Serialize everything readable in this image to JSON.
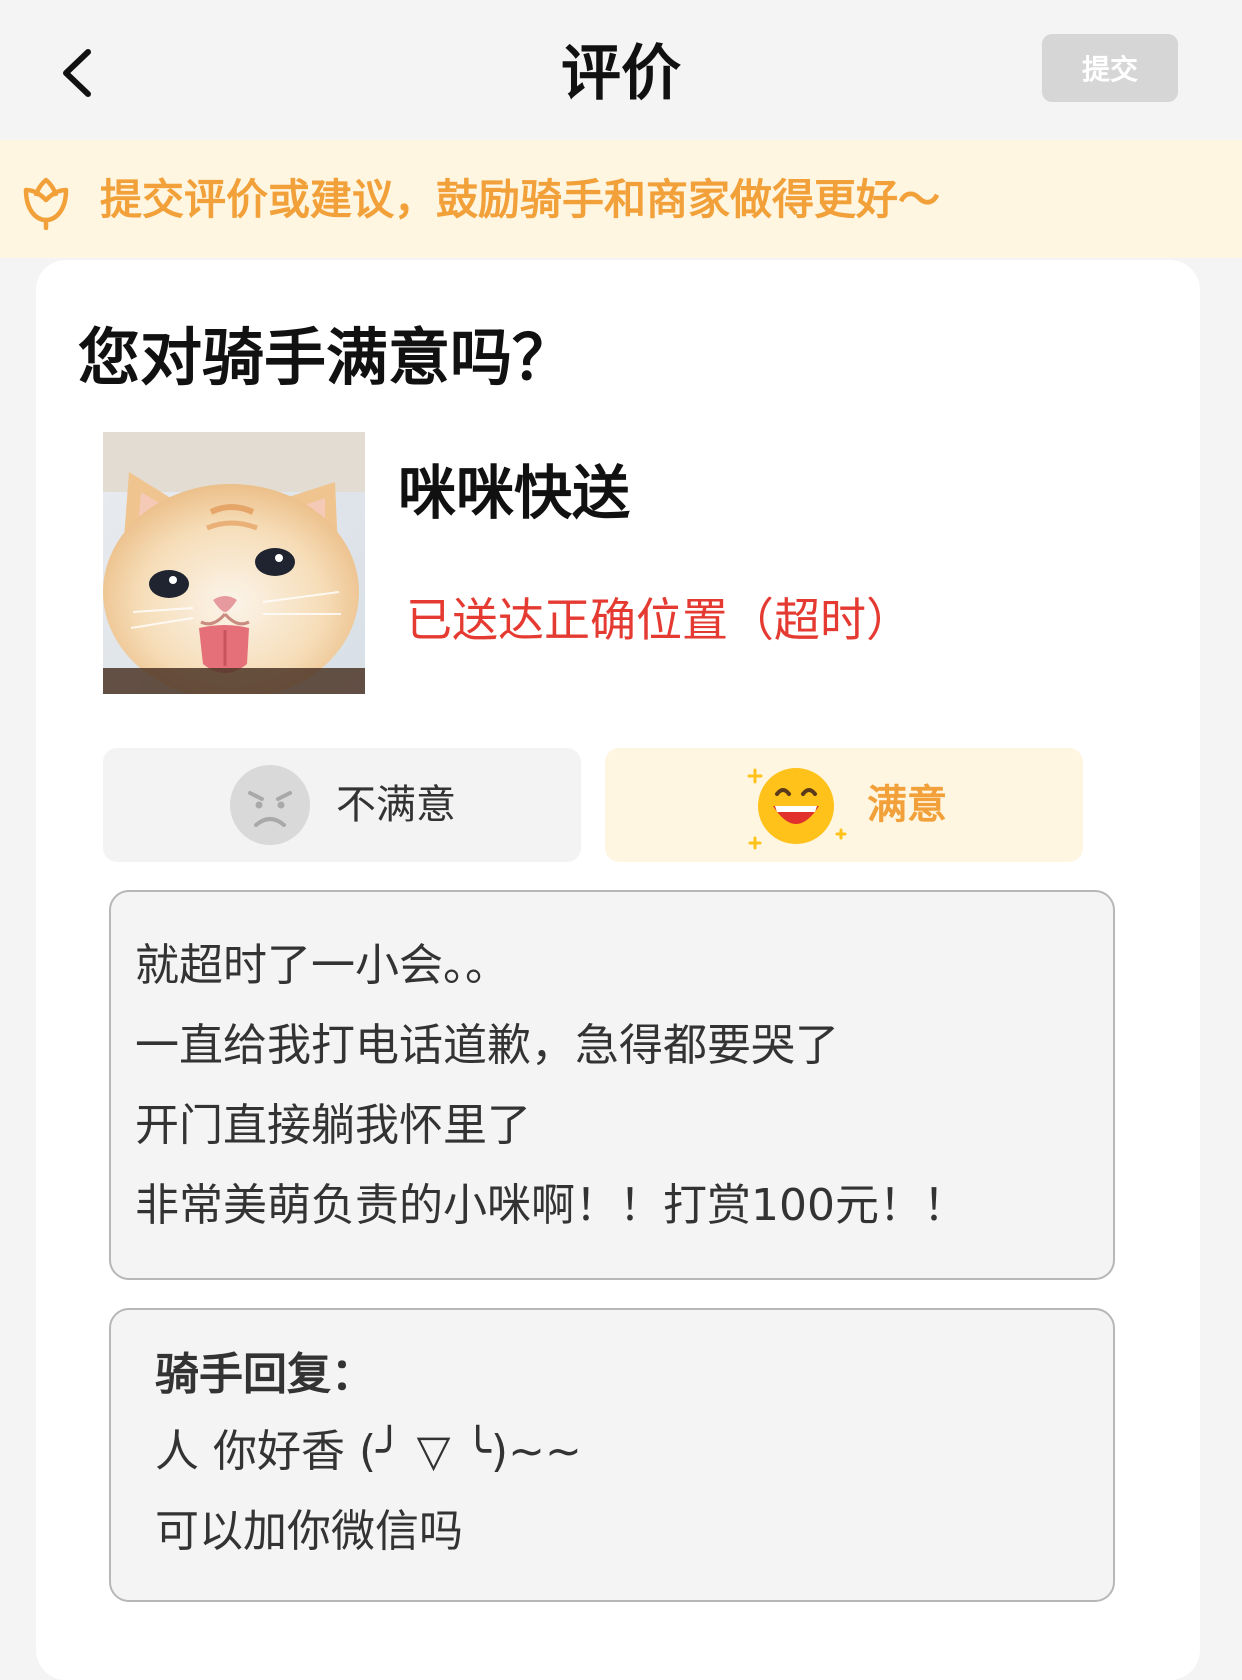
{
  "header": {
    "title": "评价",
    "submit_label": "提交",
    "back_icon": "chevron-left-icon"
  },
  "notice": {
    "icon": "flower-icon",
    "text": "提交评价或建议，鼓励骑手和商家做得更好～",
    "color": "#f2a13a"
  },
  "rider": {
    "question": "您对骑手满意吗？",
    "name": "咪咪快送",
    "status": "已送达正确位置（超时）",
    "status_color": "#e53a31",
    "avatar": "kitten-photo"
  },
  "rating": {
    "unsatisfied_label": "不满意",
    "satisfied_label": "满意",
    "selected": "满意",
    "unsatisfied_icon": "angry-face-icon",
    "satisfied_icon": "laughing-face-icon",
    "accent": "#f2a13a"
  },
  "review": {
    "lines": [
      "就超时了一小会。。",
      "一直给我打电话道歉，急得都要哭了",
      "开门直接躺我怀里了",
      "非常美萌负责的小咪啊！！打赏100元！！"
    ]
  },
  "reply": {
    "title": "骑手回复：",
    "lines": [
      "人 你好香 (╯ ▽ ╰)~~",
      "可以加你微信吗"
    ]
  }
}
